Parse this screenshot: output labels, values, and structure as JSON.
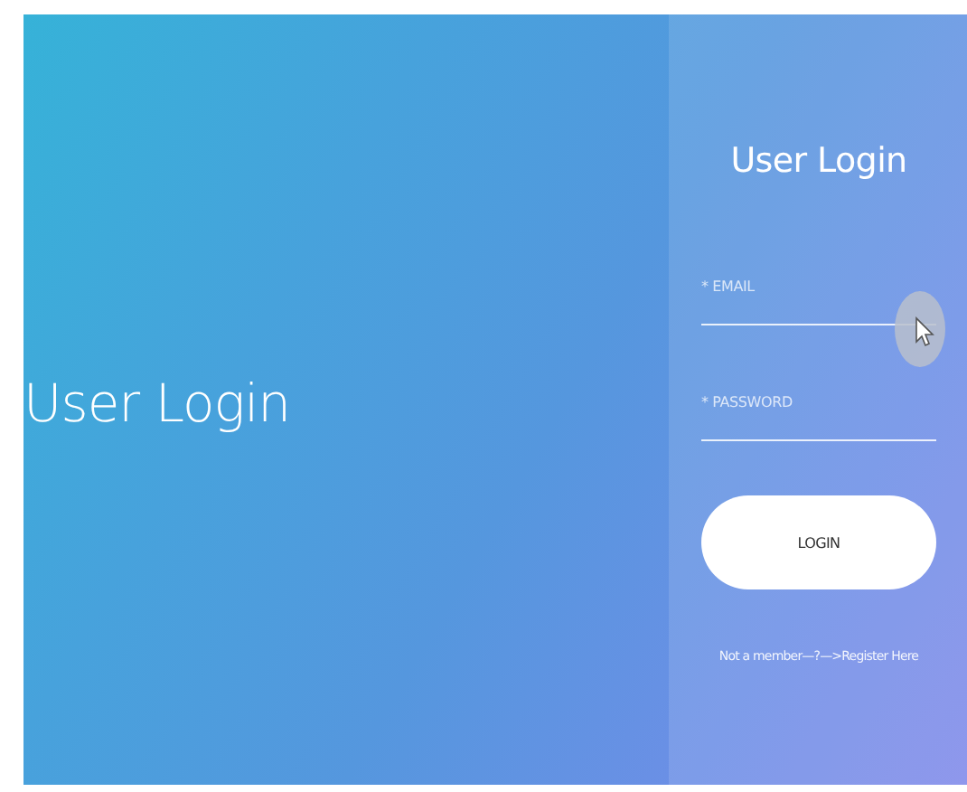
{
  "hero": {
    "title": "User Login"
  },
  "form": {
    "title": "User Login",
    "fields": [
      {
        "label": "* EMAIL"
      },
      {
        "label": "* PASSWORD"
      }
    ],
    "submit": "LOGIN",
    "register_link": "Not a member—?—>Register Here"
  }
}
